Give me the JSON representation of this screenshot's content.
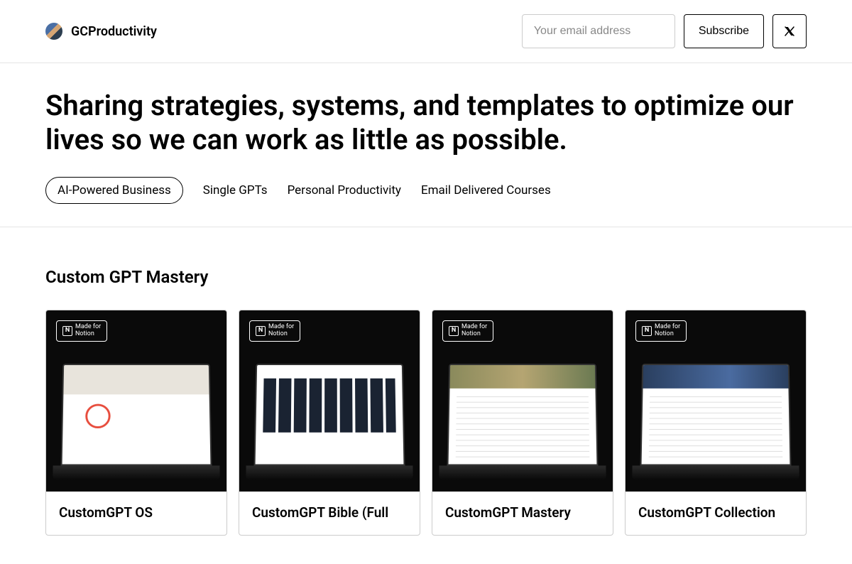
{
  "header": {
    "brand_name": "GCProductivity",
    "email_placeholder": "Your email address",
    "subscribe_label": "Subscribe"
  },
  "hero": {
    "title": "Sharing strategies, systems, and templates to optimize our lives so we can work as little as possible."
  },
  "tabs": [
    {
      "label": "AI-Powered Business",
      "active": true
    },
    {
      "label": "Single GPTs",
      "active": false
    },
    {
      "label": "Personal Productivity",
      "active": false
    },
    {
      "label": "Email Delivered Courses",
      "active": false
    }
  ],
  "section": {
    "title": "Custom GPT Mastery"
  },
  "badge": {
    "line1": "Made for",
    "line2": "Notion",
    "icon_letter": "N"
  },
  "cards": [
    {
      "title": "CustomGPT OS"
    },
    {
      "title": "CustomGPT Bible (Full"
    },
    {
      "title": "CustomGPT Mastery"
    },
    {
      "title": "CustomGPT Collection"
    }
  ]
}
